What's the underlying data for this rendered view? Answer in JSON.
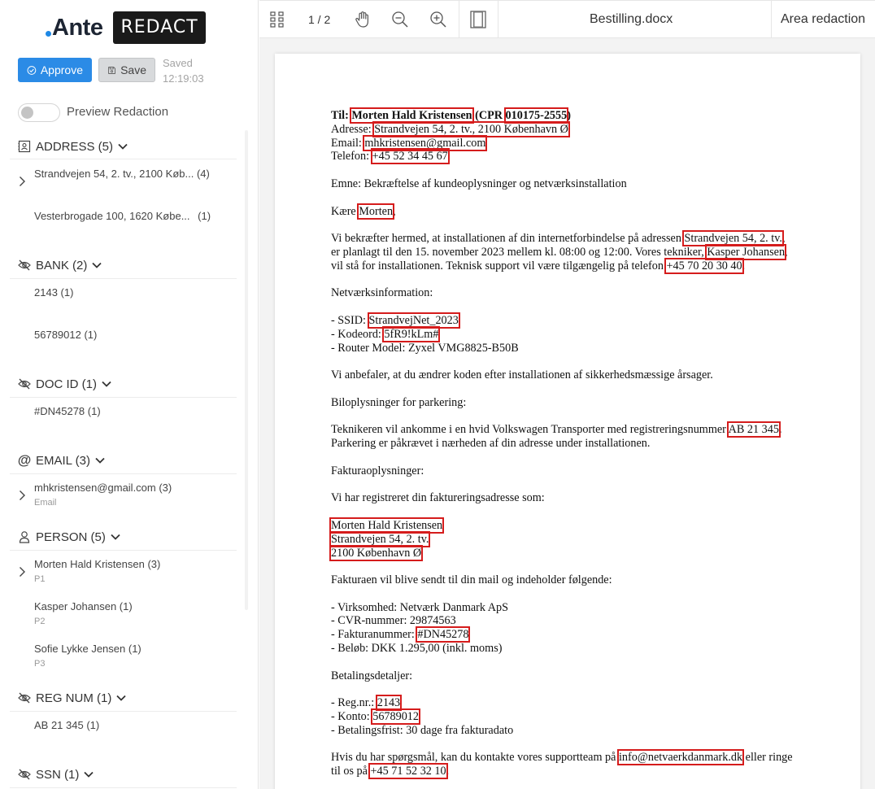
{
  "sidebar": {
    "logo": {
      "brand": "Ante",
      "product": "REDACT"
    },
    "approve_label": "Approve",
    "save_label": "Save",
    "saved_label": "Saved",
    "saved_time": "12:19:03",
    "preview_label": "Preview Redaction",
    "sections": {
      "address": {
        "title": "ADDRESS (5)",
        "items": [
          {
            "label": "Strandvejen 54, 2. tv., 2100 Køb...",
            "count": "(4)"
          },
          {
            "label": "Vesterbrogade 100, 1620 Købe...",
            "count": "(1)"
          }
        ]
      },
      "bank": {
        "title": "BANK (2)",
        "items": [
          {
            "label": "2143 (1)"
          },
          {
            "label": "56789012 (1)"
          }
        ]
      },
      "docid": {
        "title": "DOC ID (1)",
        "items": [
          {
            "label": "#DN45278 (1)"
          }
        ]
      },
      "email": {
        "title": "EMAIL (3)",
        "items": [
          {
            "label": "mhkristensen@gmail.com (3)",
            "sub": "Email"
          }
        ]
      },
      "person": {
        "title": "PERSON (5)",
        "items": [
          {
            "label": "Morten Hald Kristensen (3)",
            "sub": "P1"
          },
          {
            "label": "Kasper Johansen (1)",
            "sub": "P2"
          },
          {
            "label": "Sofie Lykke Jensen (1)",
            "sub": "P3"
          }
        ]
      },
      "regnum": {
        "title": "REG NUM (1)",
        "items": [
          {
            "label": "AB 21 345 (1)"
          }
        ]
      },
      "ssn": {
        "title": "SSN (1)"
      }
    }
  },
  "toolbar": {
    "page_count": "1 / 2",
    "doc_title": "Bestilling.docx",
    "area_redaction": "Area redaction"
  },
  "doc": {
    "to_label": "Til:",
    "to_name": "Morten Hald Kristensen",
    "cpr_prefix": "(CPR",
    "cpr": "010175-2555",
    "cpr_suffix": ")",
    "addr_label": "Adresse:",
    "addr": "Strandvejen 54, 2. tv., 2100 København Ø",
    "email_label": "Email:",
    "email": "mhkristensen@gmail.com",
    "tel_label": "Telefon:",
    "tel": "+45 52 34 45 67",
    "subject": "Emne: Bekræftelse af kundeoplysninger og netværksinstallation",
    "greet_prefix": "Kære",
    "greet_name": "Morten",
    "greet_suffix": ",",
    "p1a": "Vi bekræfter hermed, at installationen af din internetforbindelse på adressen",
    "p1_addr": "Strandvejen 54, 2. tv.",
    "p1b": ",",
    "p2a": "er planlagt til den 15. november 2023 mellem kl. 08:00 og 12:00. Vores tekniker,",
    "p2_name": "Kasper Johansen",
    "p2b": ",",
    "p3a": "vil stå for installationen. Teknisk support vil være tilgængelig på telefon",
    "p3_tel": "+45 70 20 30 40",
    "p3b": ".",
    "net_head": "Netværksinformation:",
    "ssid_label": "- SSID:",
    "ssid": "StrandvejNet_2023",
    "code_label": "- Kodeord:",
    "code": "5fR9!kLm#",
    "router": "- Router Model: Zyxel VMG8825-B50B",
    "advice": "Vi anbefaler, at du ændrer koden efter installationen af sikkerhedsmæssige årsager.",
    "car_head": "Biloplysninger for parkering:",
    "car1a": "Teknikeren vil ankomme i en hvid Volkswagen Transporter med registreringsnummer",
    "car_reg": "AB 21 345",
    "car1b": ".",
    "car2": "Parkering er påkrævet i nærheden af din adresse under installationen.",
    "inv_head": "Fakturaoplysninger:",
    "inv_intro": "Vi har registreret din faktureringsadresse som:",
    "inv_name": "Morten Hald Kristensen",
    "inv_street": "Strandvejen 54, 2. tv.",
    "inv_city": "2100 København Ø",
    "inv_send": "Fakturaen vil blive sendt til din mail og indeholder følgende:",
    "inv_company": "- Virksomhed: Netværk Danmark ApS",
    "inv_cvr": "- CVR-nummer: 29874563",
    "inv_no_label": "- Fakturanummer:",
    "inv_no": "#DN45278",
    "inv_amount": "- Beløb: DKK 1.295,00 (inkl. moms)",
    "pay_head": "Betalingsdetaljer:",
    "reg_label": "- Reg.nr.:",
    "reg": "2143",
    "acct_label": "- Konto:",
    "acct": "56789012",
    "due": "- Betalingsfrist: 30 dage fra fakturadato",
    "contact_a": "Hvis du har spørgsmål, kan du kontakte vores supportteam på",
    "contact_email": "info@netvaerkdanmark.dk",
    "contact_b": "eller ringe",
    "contact_c": "til os på",
    "contact_tel": "+45 71 52 32 10",
    "contact_d": "."
  },
  "colors": {
    "accent": "#2b8be6",
    "redaction_box": "#d51c1c"
  }
}
